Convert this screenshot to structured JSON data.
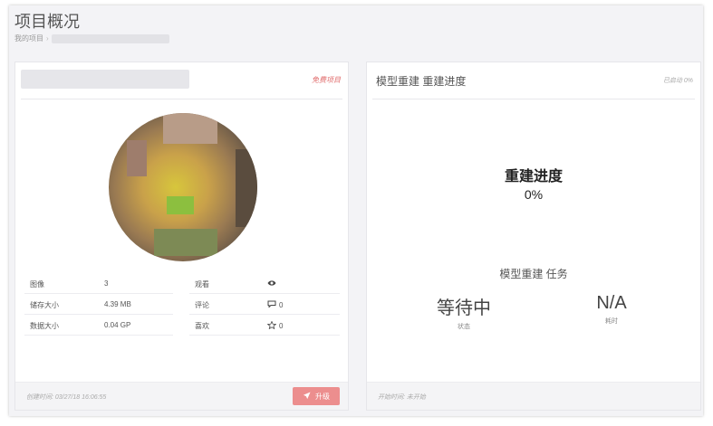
{
  "header": {
    "title": "项目概况",
    "breadcrumb_root": "我的项目"
  },
  "project_card": {
    "free_tag": "免费项目",
    "stats": [
      {
        "label": "图像",
        "value": "3"
      },
      {
        "label": "储存大小",
        "value": "4.39 MB"
      },
      {
        "label": "数据大小",
        "value": "0.04 GP"
      }
    ],
    "social": [
      {
        "label": "观看",
        "icon": "eye-icon",
        "value": ""
      },
      {
        "label": "评论",
        "icon": "comment-icon",
        "value": "0"
      },
      {
        "label": "喜欢",
        "icon": "star-icon",
        "value": "0"
      }
    ],
    "created_text": "创建时间: 03/27/18 16:06:55",
    "upgrade_label": "升级"
  },
  "rebuild_card": {
    "title": "模型重建 重建进度",
    "started_label": "已启动 0%",
    "progress_label": "重建进度",
    "progress_value": "0%",
    "progress_fraction": 0,
    "task_title": "模型重建 任务",
    "status_value": "等待中",
    "status_label": "状态",
    "duration_value": "N/A",
    "duration_label": "耗时",
    "start_text": "开始时间: 未开始"
  },
  "colors": {
    "accent": "#ec8e8e",
    "free_tag": "#e06b6b",
    "background": "#f3f3f6"
  }
}
